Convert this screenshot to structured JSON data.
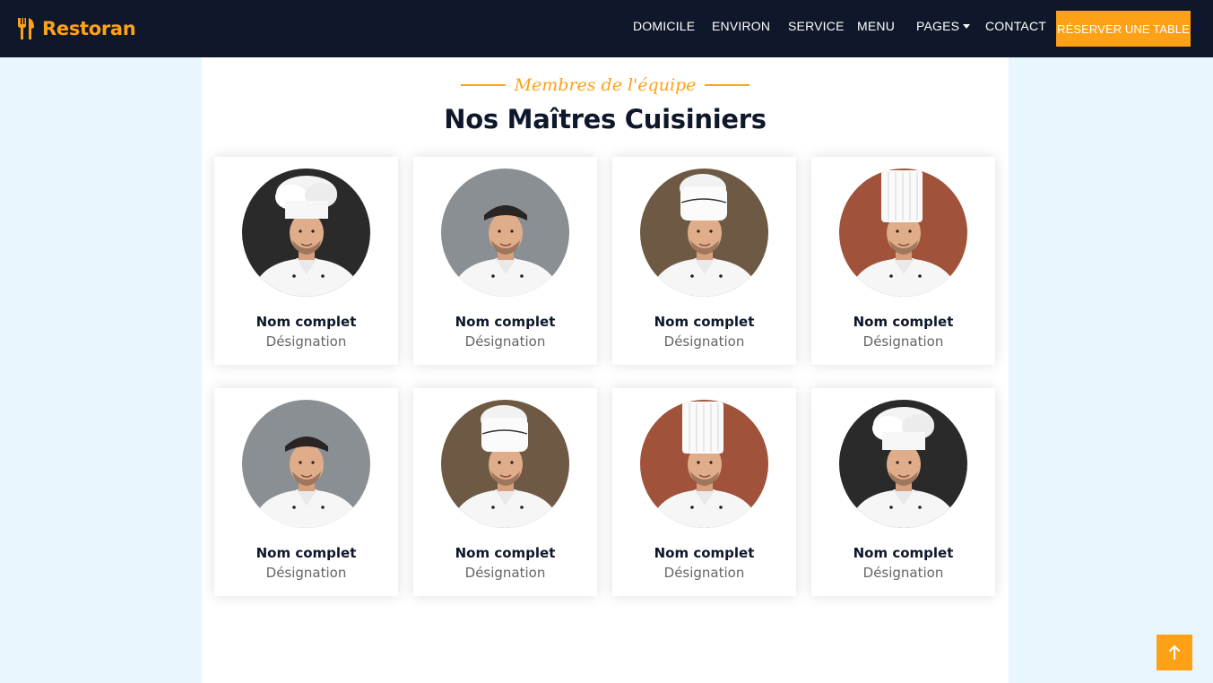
{
  "brand": {
    "name": "Restoran",
    "color": "#fea116",
    "icon": "utensils-icon"
  },
  "nav": {
    "items": [
      {
        "label": "DOMICILE"
      },
      {
        "label": "ENVIRON"
      },
      {
        "label": "SERVICE"
      },
      {
        "label": "MENU"
      },
      {
        "label": "PAGES",
        "dropdown": true
      },
      {
        "label": "CONTACT"
      }
    ],
    "cta": "RÉSERVER UNE TABLE"
  },
  "section": {
    "subtitle": "Membres de l'équipe",
    "title": "Nos Maîtres Cuisiniers"
  },
  "team": [
    {
      "name": "Nom complet",
      "role": "Désignation",
      "photo_bg": "#2a2a2a",
      "hat": "puffy"
    },
    {
      "name": "Nom complet",
      "role": "Désignation",
      "photo_bg": "#8a8f93",
      "hat": "none"
    },
    {
      "name": "Nom complet",
      "role": "Désignation",
      "photo_bg": "#6e5a44",
      "hat": "tall-round"
    },
    {
      "name": "Nom complet",
      "role": "Désignation",
      "photo_bg": "#a0523a",
      "hat": "toque"
    },
    {
      "name": "Nom complet",
      "role": "Désignation",
      "photo_bg": "#8a8f93",
      "hat": "none"
    },
    {
      "name": "Nom complet",
      "role": "Désignation",
      "photo_bg": "#6e5a44",
      "hat": "tall-round"
    },
    {
      "name": "Nom complet",
      "role": "Désignation",
      "photo_bg": "#a0523a",
      "hat": "toque"
    },
    {
      "name": "Nom complet",
      "role": "Désignation",
      "photo_bg": "#2a2a2a",
      "hat": "puffy"
    }
  ],
  "back_to_top": {
    "icon": "arrow-up-icon"
  },
  "colors": {
    "navbar": "#0f172b",
    "accent": "#fea116",
    "page_bg": "#eaf6fe"
  }
}
